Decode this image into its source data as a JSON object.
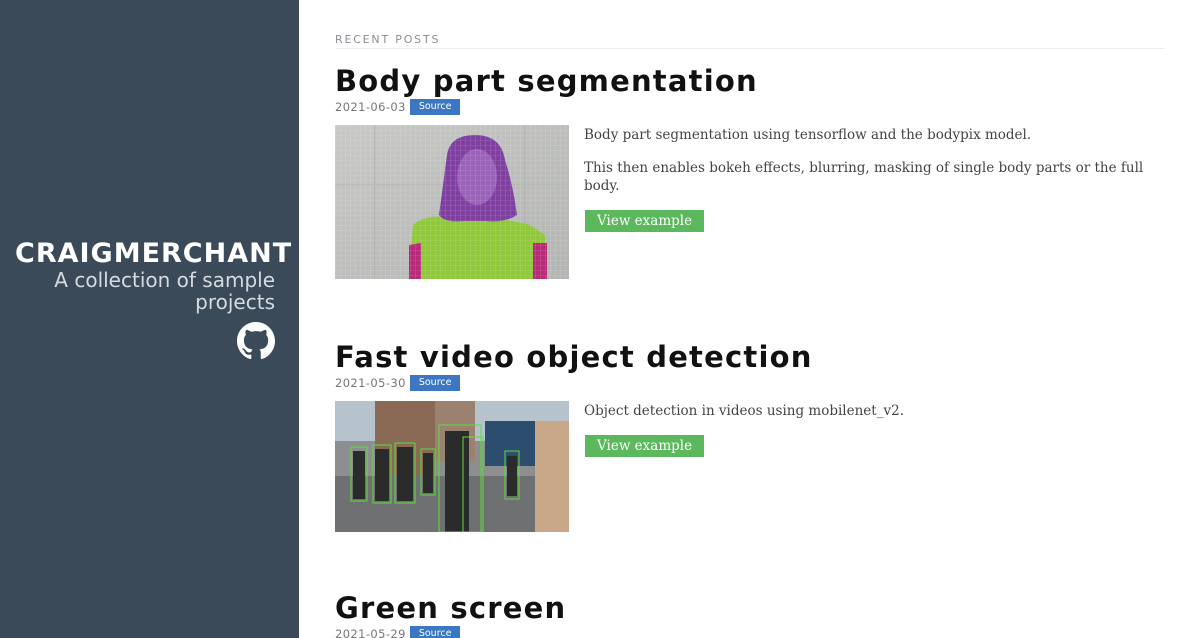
{
  "sidebar": {
    "title": "CRAIGMERCHANT",
    "tagline": "A collection of sample projects",
    "github_icon": "github-icon",
    "background": "#3a4a59"
  },
  "main": {
    "section_label": "RECENT POSTS",
    "posts": [
      {
        "title": "Body part segmentation",
        "date": "2021-06-03",
        "badge": "Source",
        "paragraphs": [
          "Body part segmentation using tensorflow and the bodypix model.",
          "This then enables bokeh effects, blurring, masking of single body parts or the full body."
        ],
        "button": "View example"
      },
      {
        "title": "Fast video object detection",
        "date": "2021-05-30",
        "badge": "Source",
        "paragraphs": [
          "Object detection in videos using mobilenet_v2."
        ],
        "button": "View example"
      },
      {
        "title": "Green screen",
        "date": "2021-05-29",
        "badge": "Source"
      }
    ]
  },
  "colors": {
    "badge": "#3c77c4",
    "button": "#5cb85c"
  }
}
